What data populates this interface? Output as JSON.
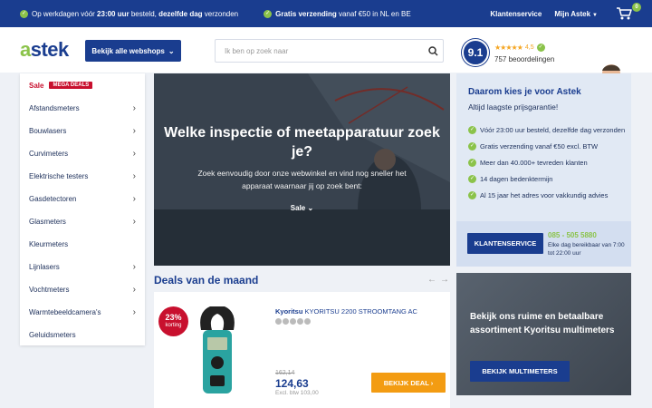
{
  "topbar": {
    "usp1_pre": "Op werkdagen vóór ",
    "usp1_time": "23:00 uur",
    "usp1_mid": " besteld, ",
    "usp1_bold": "dezelfde dag",
    "usp1_post": " verzonden",
    "usp2_bold": "Gratis verzending",
    "usp2_post": " vanaf €50 in NL en BE",
    "customer_service": "Klantenservice",
    "my_account": "Mijn Astek",
    "cart_count": "0"
  },
  "header": {
    "logo_a": "a",
    "logo_rest": "stek",
    "shops_button": "Bekijk alle webshops",
    "search_placeholder": "Ik ben op zoek naar",
    "rating_score": "9.1",
    "rating_stars": "★★★★★",
    "rating_value": "4,5",
    "reviews": "757 beoordelingen"
  },
  "sidebar": {
    "sale": "Sale",
    "mega_badge": "MEGA DEALS",
    "items": [
      {
        "label": "Afstandsmeters",
        "has_sub": true
      },
      {
        "label": "Bouwlasers",
        "has_sub": true
      },
      {
        "label": "Curvimeters",
        "has_sub": true
      },
      {
        "label": "Elektrische testers",
        "has_sub": true
      },
      {
        "label": "Gasdetectoren",
        "has_sub": true
      },
      {
        "label": "Glasmeters",
        "has_sub": true
      },
      {
        "label": "Kleurmeters",
        "has_sub": false
      },
      {
        "label": "Lijnlasers",
        "has_sub": true
      },
      {
        "label": "Vochtmeters",
        "has_sub": true
      },
      {
        "label": "Warmtebeeldcamera's",
        "has_sub": true
      },
      {
        "label": "Geluidsmeters",
        "has_sub": false
      }
    ]
  },
  "hero": {
    "title": "Welke inspectie of meetapparatuur zoek je?",
    "subtitle": "Zoek eenvoudig door onze webwinkel en vind nog sneller het apparaat waarnaar jij op zoek bent:",
    "select_label": "Sale",
    "select_chevron": "⌄"
  },
  "deals": {
    "title": "Deals van de maand",
    "prev": "←",
    "next": "→",
    "product": {
      "discount": "23%",
      "discount_label": "korting",
      "brand": "Kyoritsu",
      "name": " KYORITSU 2200 STROOMTANG AC",
      "old_price": "162,14",
      "price": "124,63",
      "excl_vat": "Excl. btw 103,00",
      "button": "BEKIJK DEAL ›"
    }
  },
  "why": {
    "title": "Daarom kies je voor Astek",
    "subtitle": "Altijd laagste prijsgarantie!",
    "items": [
      "Vóór 23:00 uur besteld, dezelfde dag verzonden",
      "Gratis verzending vanaf €50 excl. BTW",
      "Meer dan 40.000+ tevreden klanten",
      "14 dagen bedenktermijn",
      "Al 15 jaar het adres voor vakkundig advies"
    ],
    "service_button": "KLANTENSERVICE",
    "phone": "085 - 505 5880",
    "hours": "Elke dag bereikbaar van 7:00 tot 22:00 uur"
  },
  "promo": {
    "text": "Bekijk ons ruime en betaalbare assortiment Kyoritsu multimeters",
    "button": "BEKIJK MULTIMETERS"
  },
  "colors": {
    "brand_blue": "#1a3d8f",
    "brand_green": "#8bc34a",
    "sale_red": "#c8102e",
    "cta_orange": "#f39c12"
  }
}
